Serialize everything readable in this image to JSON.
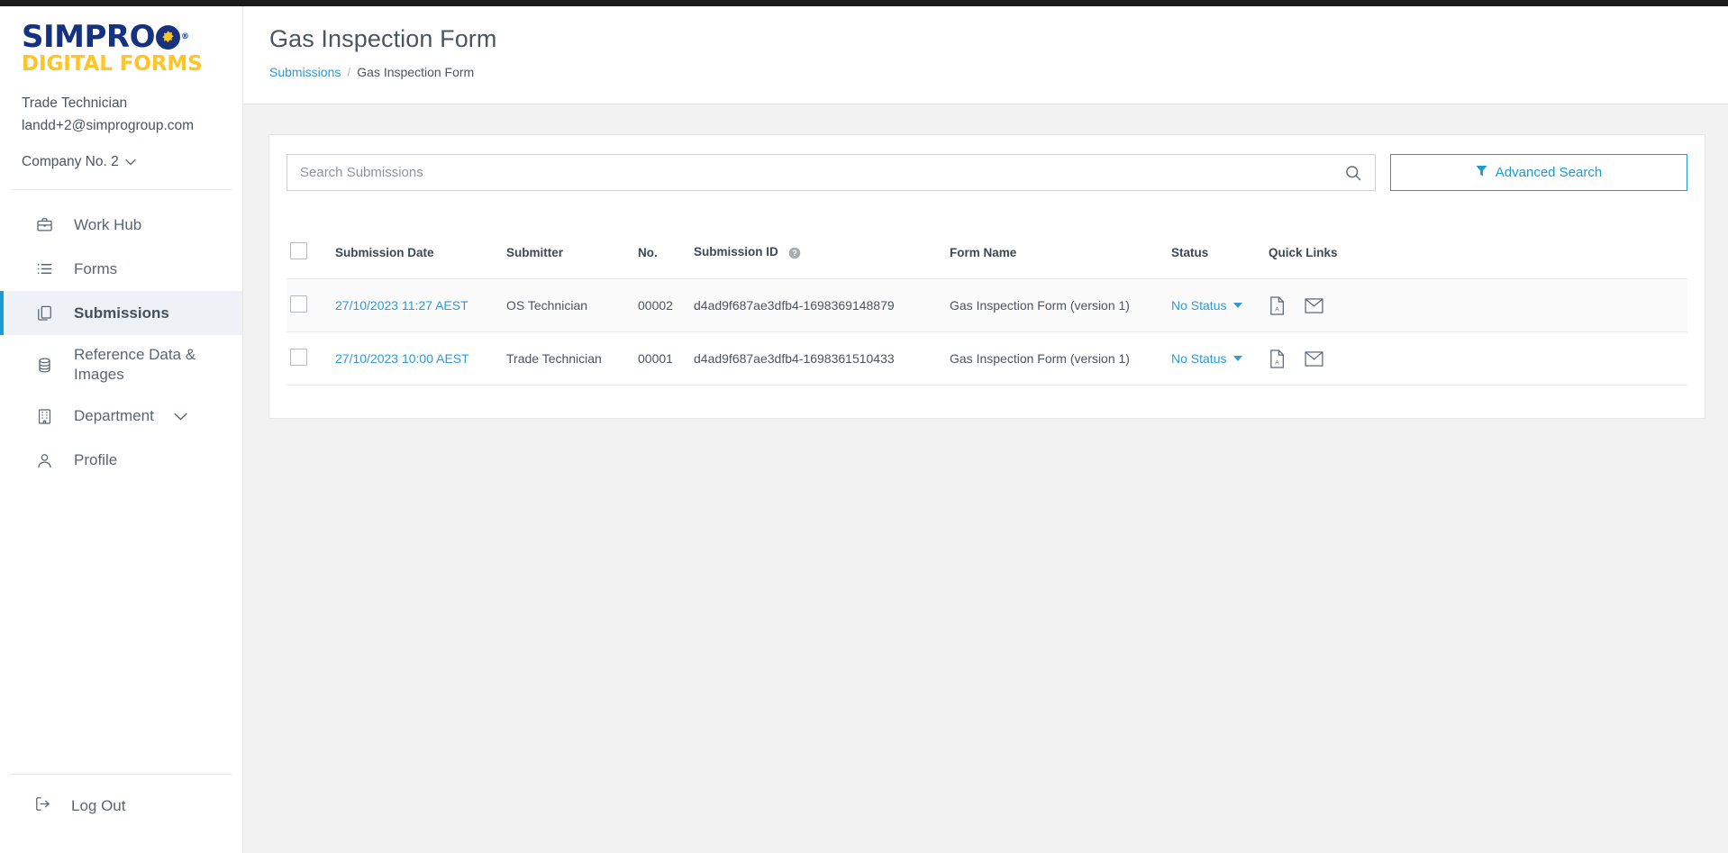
{
  "brand": {
    "logo_primary": "SIMPRO",
    "logo_secondary": "DIGITAL FORMS",
    "registered_mark": "®"
  },
  "sidebar": {
    "user_name": "Trade Technician",
    "user_email": "landd+2@simprogroup.com",
    "company_selector": "Company No. 2",
    "items": [
      {
        "label": "Work Hub",
        "icon": "briefcase-icon",
        "active": false
      },
      {
        "label": "Forms",
        "icon": "list-icon",
        "active": false
      },
      {
        "label": "Submissions",
        "icon": "copy-icon",
        "active": true
      },
      {
        "label": "Reference Data & Images",
        "icon": "database-icon",
        "active": false
      },
      {
        "label": "Department",
        "icon": "building-icon",
        "active": false,
        "expandable": true
      },
      {
        "label": "Profile",
        "icon": "user-icon",
        "active": false
      }
    ],
    "logout_label": "Log Out",
    "logout_icon": "logout-icon",
    "active_accent": "#1a9bd7"
  },
  "header": {
    "title": "Gas Inspection Form",
    "breadcrumb": {
      "parent": "Submissions",
      "separator": "/",
      "current": "Gas Inspection Form"
    }
  },
  "search": {
    "placeholder": "Search Submissions",
    "value": "",
    "icon": "search-icon",
    "advanced_button": "Advanced Search",
    "advanced_icon": "filter-icon",
    "accent": "#1a9bd7"
  },
  "table": {
    "columns": [
      {
        "key": "checkbox",
        "label": ""
      },
      {
        "key": "date",
        "label": "Submission Date"
      },
      {
        "key": "submitter",
        "label": "Submitter"
      },
      {
        "key": "no",
        "label": "No."
      },
      {
        "key": "id",
        "label": "Submission ID",
        "help": true
      },
      {
        "key": "form",
        "label": "Form Name"
      },
      {
        "key": "status",
        "label": "Status"
      },
      {
        "key": "links",
        "label": "Quick Links"
      }
    ],
    "rows": [
      {
        "date": "27/10/2023 11:27 AEST",
        "submitter": "OS Technician",
        "no": "00002",
        "id": "d4ad9f687ae3dfb4-1698369148879",
        "form": "Gas Inspection Form (version 1)",
        "status": "No Status",
        "quick_links": [
          "pdf-icon",
          "email-icon"
        ]
      },
      {
        "date": "27/10/2023 10:00 AEST",
        "submitter": "Trade Technician",
        "no": "00001",
        "id": "d4ad9f687ae3dfb4-1698361510433",
        "form": "Gas Inspection Form (version 1)",
        "status": "No Status",
        "quick_links": [
          "pdf-icon",
          "email-icon"
        ]
      }
    ],
    "link_color": "#2f9ad4"
  }
}
